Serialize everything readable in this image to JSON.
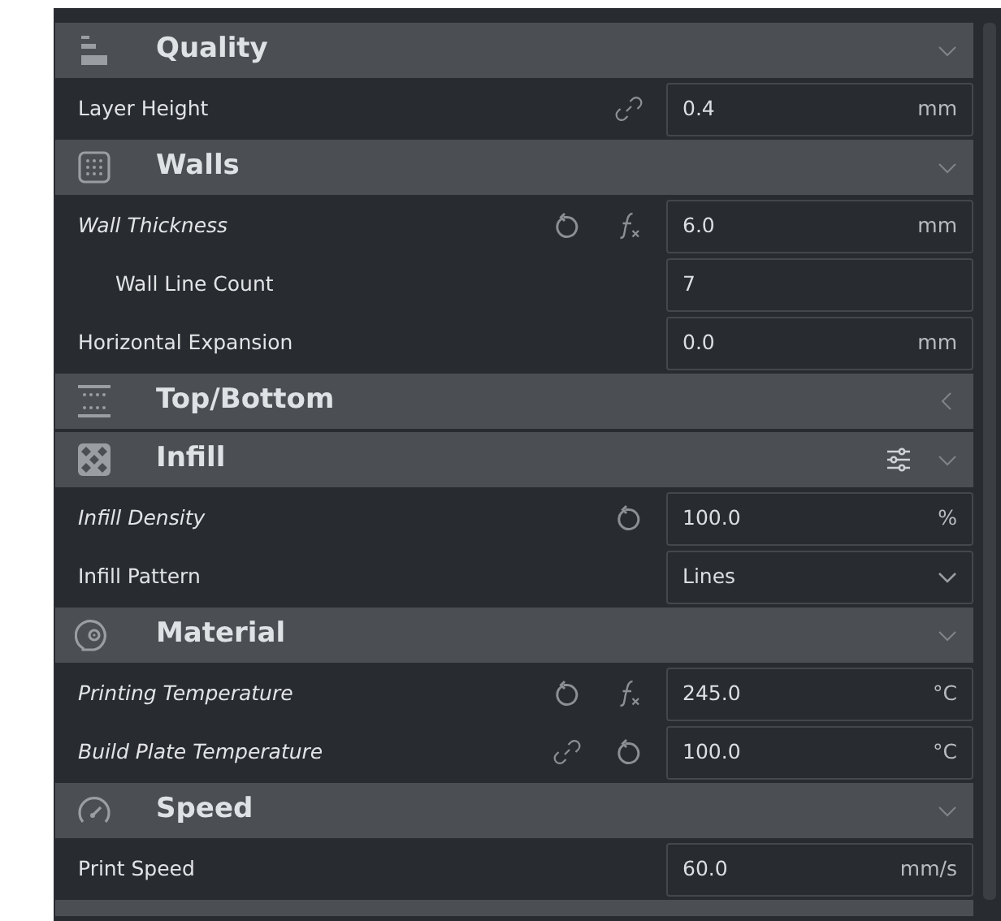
{
  "sections": [
    {
      "kind": "quality",
      "title": "Quality",
      "expanded": true,
      "settings_button": false,
      "settings": [
        {
          "label": "Layer Height",
          "modified": false,
          "linked": true,
          "resettable": false,
          "formula": false,
          "field": {
            "kind": "number",
            "value": "0.4",
            "unit": "mm"
          }
        }
      ]
    },
    {
      "kind": "walls",
      "title": "Walls",
      "expanded": true,
      "settings_button": false,
      "settings": [
        {
          "label": "Wall Thickness",
          "modified": true,
          "linked": false,
          "resettable": true,
          "formula": true,
          "field": {
            "kind": "number",
            "value": "6.0",
            "unit": "mm"
          },
          "children": [
            {
              "label": "Wall Line Count",
              "modified": false,
              "linked": false,
              "resettable": false,
              "formula": false,
              "field": {
                "kind": "number",
                "value": "7"
              }
            }
          ]
        },
        {
          "label": "Horizontal Expansion",
          "modified": false,
          "linked": false,
          "resettable": false,
          "formula": false,
          "field": {
            "kind": "number",
            "value": "0.0",
            "unit": "mm"
          }
        }
      ]
    },
    {
      "kind": "topbottom",
      "title": "Top/Bottom",
      "expanded": false,
      "settings_button": false
    },
    {
      "kind": "infill",
      "title": "Infill",
      "expanded": true,
      "settings_button": true,
      "settings": [
        {
          "label": "Infill Density",
          "modified": true,
          "linked": false,
          "resettable": true,
          "formula": false,
          "field": {
            "kind": "number",
            "value": "100.0",
            "unit": "%"
          }
        },
        {
          "label": "Infill Pattern",
          "modified": false,
          "linked": false,
          "resettable": false,
          "formula": false,
          "field": {
            "kind": "dropdown",
            "value": "Lines"
          }
        }
      ]
    },
    {
      "kind": "material",
      "title": "Material",
      "expanded": true,
      "settings_button": false,
      "settings": [
        {
          "label": "Printing Temperature",
          "modified": true,
          "linked": false,
          "resettable": true,
          "formula": true,
          "field": {
            "kind": "number",
            "value": "245.0",
            "unit": "°C"
          }
        },
        {
          "label": "Build Plate Temperature",
          "modified": true,
          "linked": true,
          "resettable": true,
          "formula": false,
          "field": {
            "kind": "number",
            "value": "100.0",
            "unit": "°C"
          }
        }
      ]
    },
    {
      "kind": "speed",
      "title": "Speed",
      "expanded": true,
      "settings_button": false,
      "settings": [
        {
          "label": "Print Speed",
          "modified": false,
          "linked": false,
          "resettable": false,
          "formula": false,
          "field": {
            "kind": "number",
            "value": "60.0",
            "unit": "mm/s"
          }
        }
      ]
    }
  ]
}
